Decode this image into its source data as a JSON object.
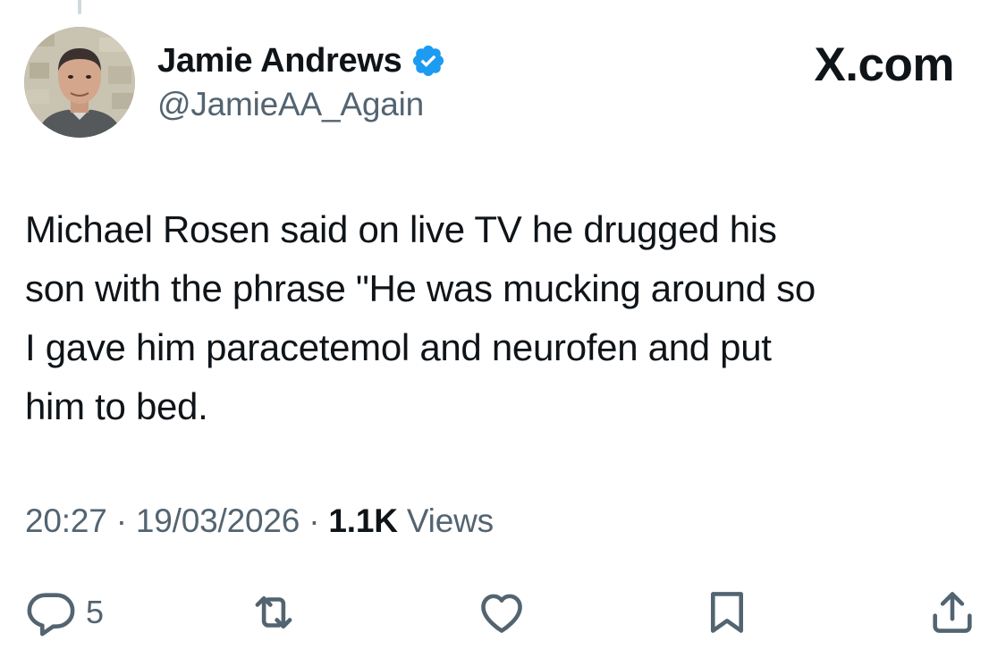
{
  "author": {
    "display_name": "Jamie Andrews",
    "handle": "@JamieAA_Again",
    "verified_color": "#1d9bf0"
  },
  "source_label": "X.com",
  "tweet": {
    "lines": [
      "Michael Rosen said on live TV he drugged his",
      "son with the phrase \"He was mucking around so",
      "I gave him paracetemol and neurofen and put",
      "him to bed."
    ]
  },
  "meta": {
    "time": "20:27",
    "date": "19/03/2026",
    "views_count": "1.1K",
    "views_label": "Views",
    "separator": "·"
  },
  "actions": {
    "reply_count": "5",
    "icons": [
      "reply-icon",
      "retweet-icon",
      "like-icon",
      "bookmark-icon",
      "share-icon"
    ]
  },
  "colors": {
    "text": "#0f1419",
    "secondary": "#536471",
    "verified": "#1d9bf0"
  }
}
